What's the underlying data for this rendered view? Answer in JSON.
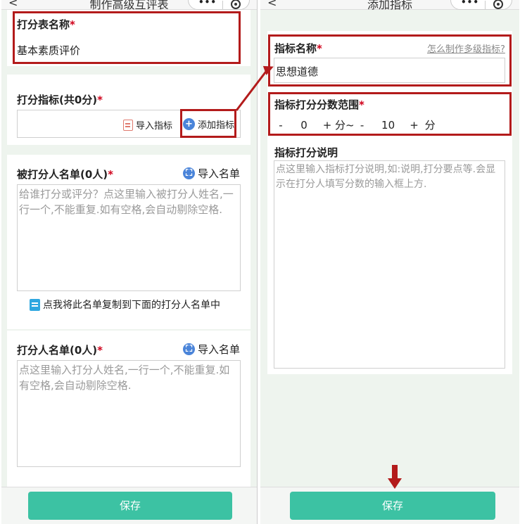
{
  "left": {
    "title": "制作高级互评表",
    "back_symbol": "<",
    "name_section": {
      "label": "打分表名称",
      "required": "*",
      "value": "基本素质评价"
    },
    "criteria_section": {
      "label": "打分指标(共0分)",
      "required": "*",
      "import_label": "导入指标",
      "add_label": "添加指标"
    },
    "rated_section": {
      "label": "被打分人名单(0人)",
      "required": "*",
      "import_label": "导入名单",
      "placeholder": "给谁打分或评分？点这里输入被打分人姓名,一行一个,不能重复.如有空格,会自动剔除空格."
    },
    "copy_hint": "点我将此名单复制到下面的打分人名单中",
    "raters_section": {
      "label": "打分人名单(0人)",
      "required": "*",
      "import_label": "导入名单",
      "placeholder": "点这里输入打分人姓名,一行一个,不能重复.如有空格,会自动剔除空格."
    },
    "save_label": "保存"
  },
  "right": {
    "title": "添加指标",
    "back_symbol": "<",
    "name_section": {
      "label": "指标名称",
      "required": "*",
      "help_link": "怎么制作多级指标?",
      "value": "思想道德"
    },
    "range_section": {
      "label": "指标打分分数范围",
      "required": "*",
      "min_value": "0",
      "max_value": "10",
      "minus": "-",
      "plus": "+",
      "unit_sep": "分~",
      "unit": "分"
    },
    "desc_section": {
      "label": "指标打分说明",
      "placeholder": "点这里输入指标打分说明,如:说明,打分要点等.会显示在打分人填写分数的输入框上方."
    },
    "save_label": "保存"
  },
  "capsule": {
    "menu_icon": "•••"
  },
  "colors": {
    "accent": "#3cc2a3",
    "highlight": "#b31b1b",
    "icon_blue": "#4a84d9",
    "required": "#d0021b"
  }
}
